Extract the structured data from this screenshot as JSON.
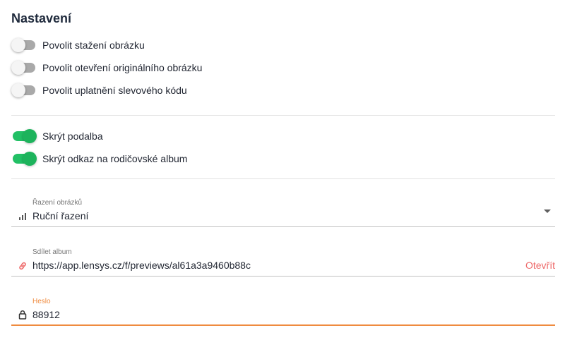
{
  "title": "Nastavení",
  "toggles_group1": [
    {
      "label": "Povolit stažení obrázku",
      "on": false
    },
    {
      "label": "Povolit otevření originálního obrázku",
      "on": false
    },
    {
      "label": "Povolit uplatnění slevového kódu",
      "on": false
    }
  ],
  "toggles_group2": [
    {
      "label": "Skrýt podalba",
      "on": true
    },
    {
      "label": "Skrýt odkaz na rodičovské album",
      "on": true
    }
  ],
  "sort": {
    "label": "Řazení obrázků",
    "value": "Ruční řazení",
    "icon": "bar-chart-icon"
  },
  "share": {
    "label": "Sdílet album",
    "value": "https://app.lensys.cz/f/previews/al61a3a9460b88c",
    "open_label": "Otevřít",
    "icon": "link-icon"
  },
  "password": {
    "label": "Heslo",
    "value": "88912",
    "icon": "lock-icon"
  },
  "colors": {
    "toggle_on": "#22c065",
    "toggle_off": "#a9a9a9",
    "focus_accent": "#ef8b3f",
    "link_accent": "#ee6a6a"
  }
}
